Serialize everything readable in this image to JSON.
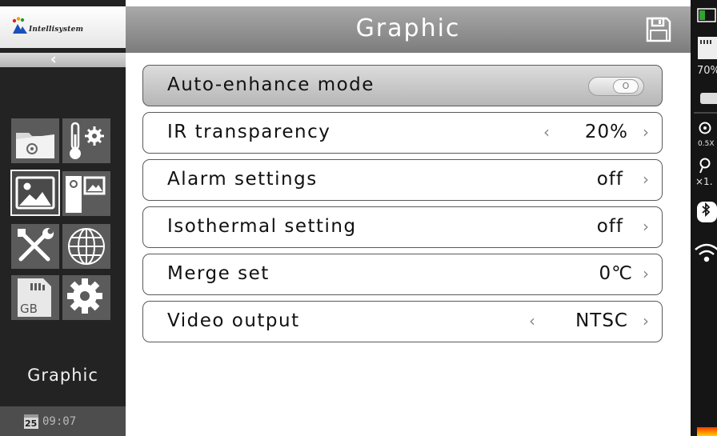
{
  "sidebar": {
    "logo_text": "Intellisystem",
    "back_icon": "chevron-left-icon",
    "menu_tiles": [
      {
        "icon": "folder-settings-icon"
      },
      {
        "icon": "thermometer-settings-icon"
      },
      {
        "icon": "image-icon",
        "selected": true
      },
      {
        "icon": "picture-in-picture-icon"
      },
      {
        "icon": "tools-icon"
      },
      {
        "icon": "globe-icon"
      },
      {
        "icon": "sd-card-icon",
        "label": "GB"
      },
      {
        "icon": "gear-icon"
      }
    ],
    "title": "Graphic",
    "clock": {
      "day": "25",
      "time": "09:07"
    }
  },
  "header": {
    "title": "Graphic",
    "save_icon": "save-icon"
  },
  "settings": [
    {
      "label": "Auto-enhance mode",
      "type": "toggle",
      "toggle_text": "O",
      "state": "off"
    },
    {
      "label": "IR transparency",
      "type": "stepper",
      "value": "20%"
    },
    {
      "label": "Alarm settings",
      "type": "link",
      "value": "off"
    },
    {
      "label": "Isothermal setting",
      "type": "link",
      "value": "off"
    },
    {
      "label": "Merge set",
      "type": "link",
      "value": "0℃"
    },
    {
      "label": "Video output",
      "type": "stepper",
      "value": "NTSC"
    }
  ],
  "status_bar": {
    "battery_percent": "70%",
    "emissivity": "0.5X",
    "zoom": "×1.",
    "icons": [
      "battery-icon",
      "sd-card-icon",
      "toggle-icon",
      "emissivity-icon",
      "zoom-icon",
      "bluetooth-icon",
      "wifi-icon",
      "palette-icon"
    ],
    "colors": {
      "battery": "#2fa52f",
      "palette_top": "#ff3a00",
      "palette_bottom": "#ffd000"
    }
  }
}
